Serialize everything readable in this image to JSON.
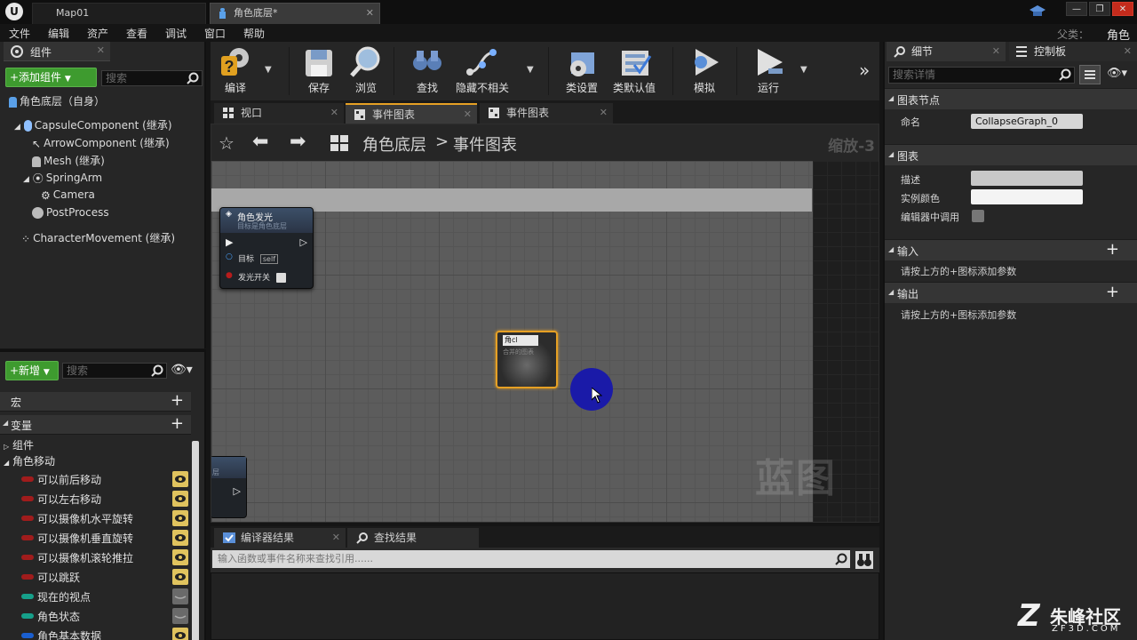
{
  "app": {
    "logo": "U",
    "tabs": [
      {
        "label": "Map01",
        "active": false
      },
      {
        "label": "角色底层*",
        "active": true
      }
    ],
    "window_controls": [
      "minimize",
      "maximize",
      "close"
    ]
  },
  "menubar": {
    "items": [
      "文件",
      "编辑",
      "资产",
      "查看",
      "调试",
      "窗口",
      "帮助"
    ],
    "parent_label": "父类：",
    "parent_value": "角色"
  },
  "components": {
    "tab_label": "组件",
    "add_button": "+添加组件",
    "search_placeholder": "搜索",
    "root": "角色底层（自身）",
    "tree": [
      {
        "label": "CapsuleComponent (继承)",
        "depth": 1,
        "icon": "capsule-icon"
      },
      {
        "label": "ArrowComponent (继承)",
        "depth": 2,
        "icon": "arrow-icon"
      },
      {
        "label": "Mesh (继承)",
        "depth": 2,
        "icon": "mesh-icon"
      },
      {
        "label": "SpringArm",
        "depth": 2,
        "icon": "spring-arm-icon"
      },
      {
        "label": "Camera",
        "depth": 3,
        "icon": "camera-icon"
      },
      {
        "label": "PostProcess",
        "depth": 2,
        "icon": "post-process-icon"
      },
      {
        "label": "CharacterMovement (继承)",
        "depth": 1,
        "icon": "movement-icon"
      }
    ]
  },
  "my_blueprint": {
    "new_button": "+新增",
    "search_placeholder": "搜索",
    "macro_label": "宏",
    "variables_label": "变量",
    "categories": [
      "组件",
      "角色移动"
    ],
    "variables": [
      {
        "name": "可以前后移动",
        "color": "#a01c1c",
        "visible": true
      },
      {
        "name": "可以左右移动",
        "color": "#a01c1c",
        "visible": true
      },
      {
        "name": "可以摄像机水平旋转",
        "color": "#a01c1c",
        "visible": true
      },
      {
        "name": "可以摄像机垂直旋转",
        "color": "#a01c1c",
        "visible": true
      },
      {
        "name": "可以摄像机滚轮推拉",
        "color": "#a01c1c",
        "visible": true
      },
      {
        "name": "可以跳跃",
        "color": "#a01c1c",
        "visible": true
      },
      {
        "name": "现在的视点",
        "color": "#16a08a",
        "visible": false
      },
      {
        "name": "角色状态",
        "color": "#16a08a",
        "visible": false
      },
      {
        "name": "角色基本数据",
        "color": "#1a5fd0",
        "visible": true
      }
    ]
  },
  "toolbar": {
    "buttons": [
      {
        "label": "编译",
        "icon": "compile-icon"
      },
      {
        "label": "保存",
        "icon": "save-icon"
      },
      {
        "label": "浏览",
        "icon": "browse-icon"
      },
      {
        "label": "查找",
        "icon": "find-icon"
      },
      {
        "label": "隐藏不相关",
        "icon": "hide-unrelated-icon"
      },
      {
        "label": "类设置",
        "icon": "class-settings-icon"
      },
      {
        "label": "类默认值",
        "icon": "class-defaults-icon"
      },
      {
        "label": "模拟",
        "icon": "simulate-icon"
      },
      {
        "label": "运行",
        "icon": "play-icon"
      }
    ],
    "overflow": "»"
  },
  "graph_tabs": [
    {
      "label": "视口",
      "active": false
    },
    {
      "label": "事件图表",
      "active": true
    },
    {
      "label": "事件图表",
      "active": false
    }
  ],
  "graph": {
    "breadcrumb_root": "角色底层",
    "breadcrumb_sep": ">",
    "breadcrumb_current": "事件图表",
    "zoom": "缩放-3",
    "watermark": "蓝图",
    "node_glow": {
      "title": "角色发光",
      "subtitle": "目标是角色底层",
      "target_label": "目标",
      "target_value": "self",
      "toggle_label": "发光开关"
    },
    "node_collapsed": {
      "name_value": "角cl",
      "subtitle": "合并的图表"
    },
    "node_partial_label": "层"
  },
  "results": {
    "tabs": [
      "编译器结果",
      "查找结果"
    ],
    "search_placeholder": "输入函数或事件名称来查找引用......"
  },
  "details": {
    "tabs": [
      "细节",
      "控制板"
    ],
    "search_placeholder": "搜索详情",
    "sections": {
      "graph_node": "图表节点",
      "graph": "图表",
      "inputs": "输入",
      "outputs": "输出"
    },
    "name_label": "命名",
    "name_value": "CollapseGraph_0",
    "desc_label": "描述",
    "instance_color_label": "实例颜色",
    "call_in_editor_label": "编辑器中调用",
    "inputs_hint": "请按上方的+图标添加参数",
    "outputs_hint": "请按上方的+图标添加参数"
  },
  "brand": {
    "name": "朱峰社区",
    "url": "ZF3D.COM"
  }
}
